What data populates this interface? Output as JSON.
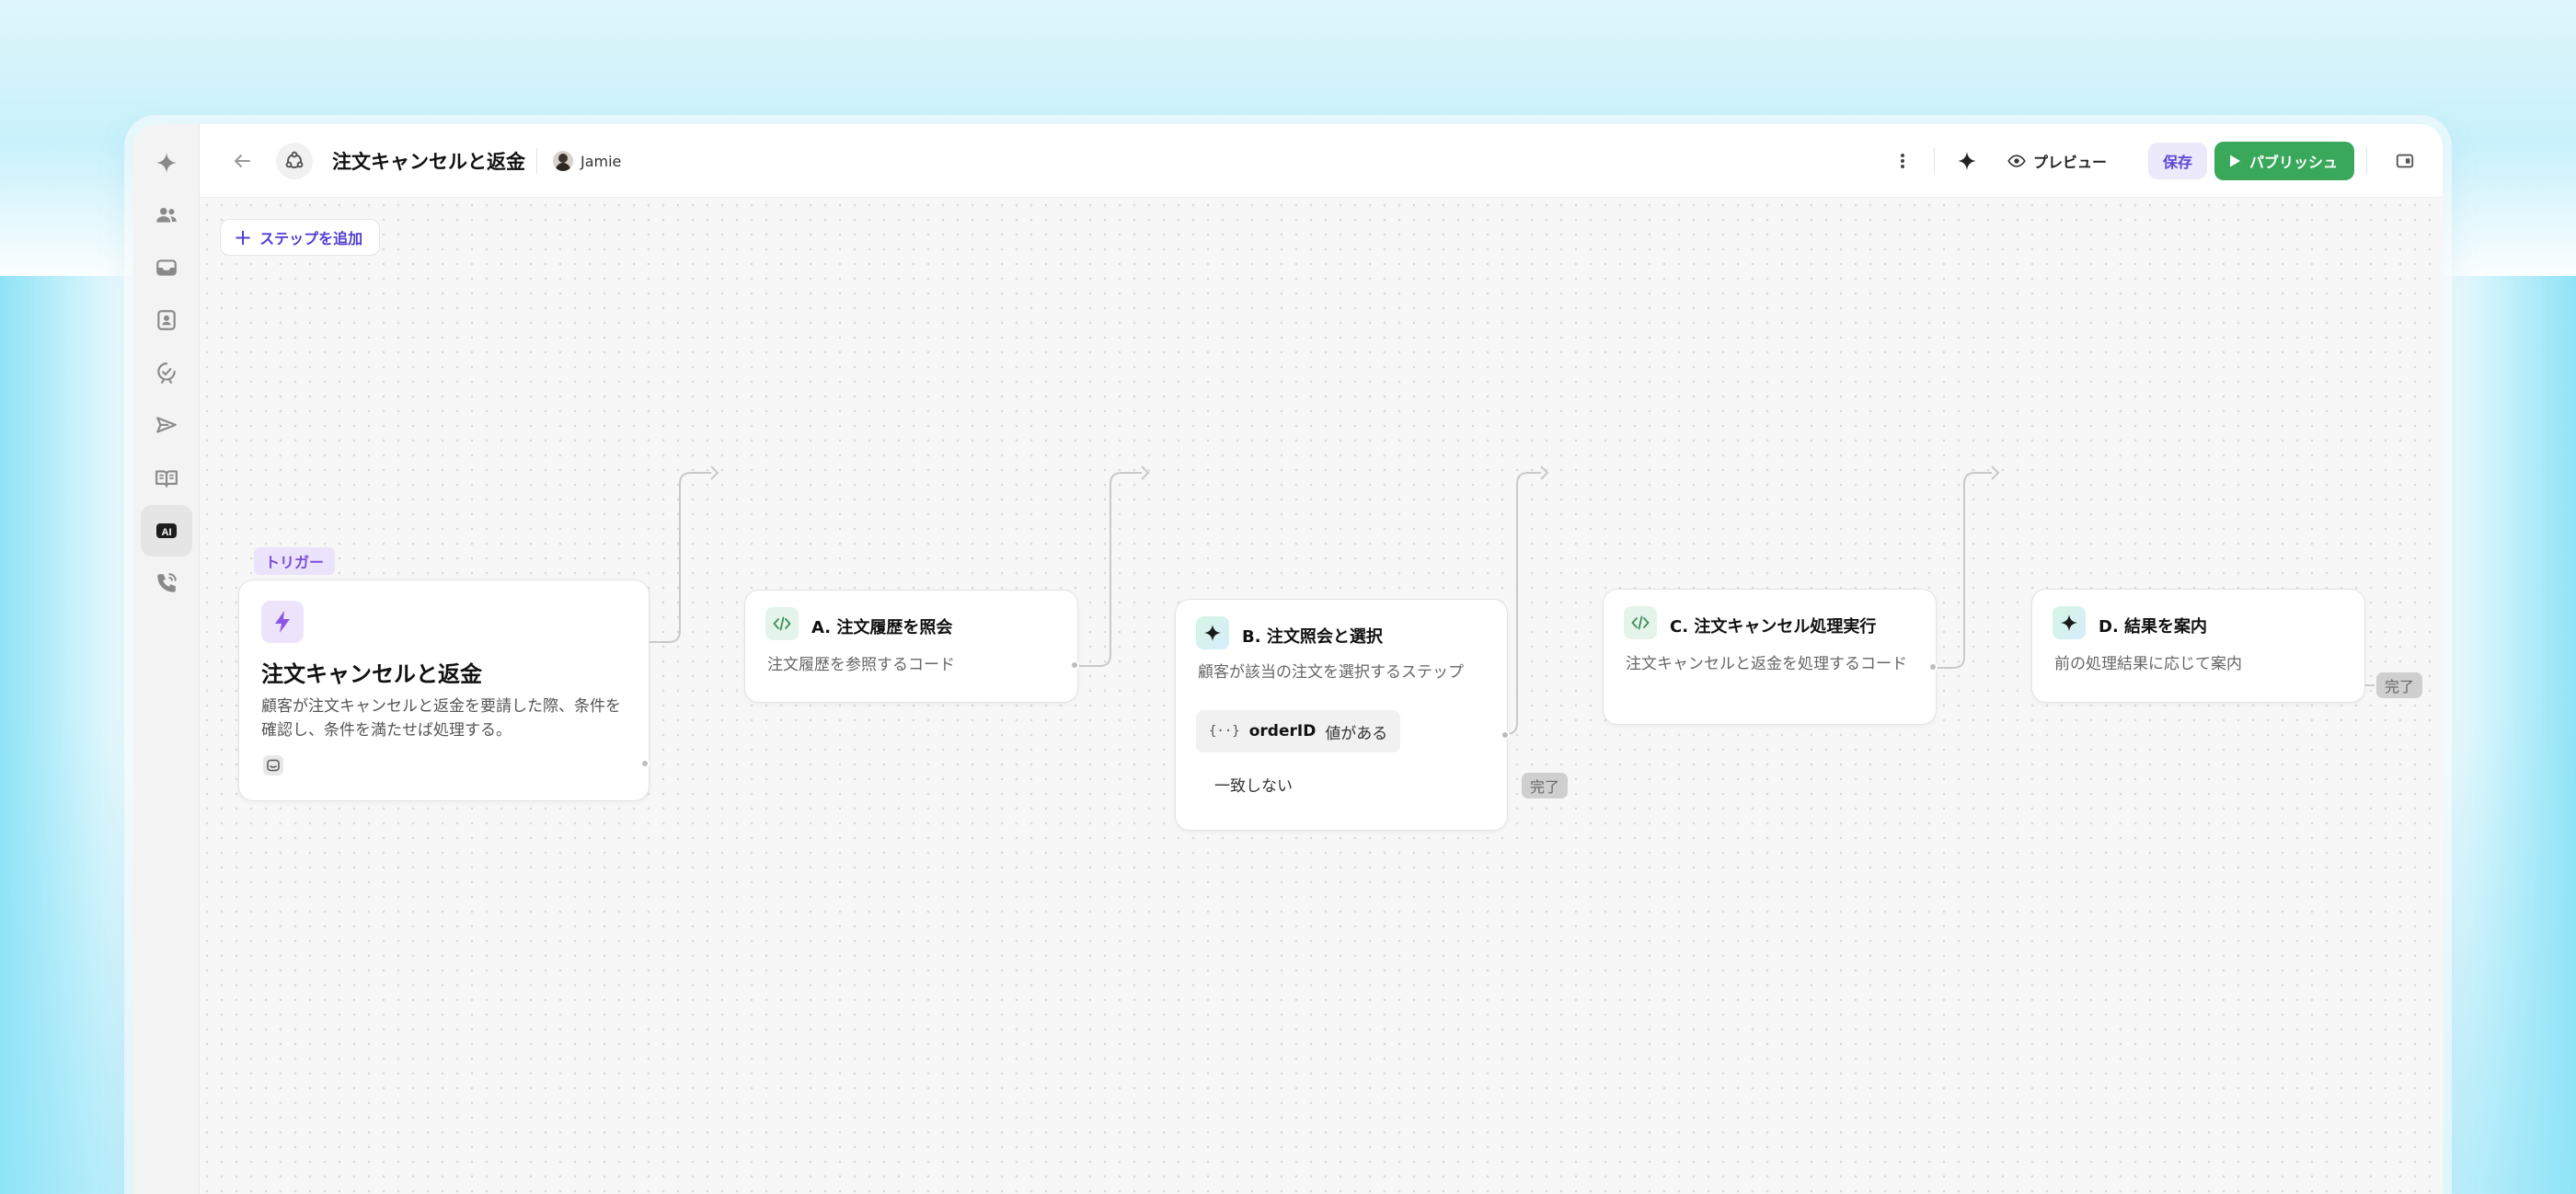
{
  "topbar": {
    "title": "注文キャンセルと返金",
    "owner": "Jamie",
    "preview_label": "プレビュー",
    "save_label": "保存",
    "publish_label": "パブリッシュ"
  },
  "rail": {
    "items": [
      "sparkle",
      "users",
      "inbox",
      "contacts",
      "verified",
      "send",
      "knowledge",
      "ai",
      "phone"
    ],
    "active": "ai",
    "ai_badge": "AI"
  },
  "canvas": {
    "add_step_label": "ステップを追加",
    "trigger": {
      "tag": "トリガー",
      "title": "注文キャンセルと返金",
      "description": "顧客が注文キャンセルと返金を要請した際、条件を確認し、条件を満たせば処理する。"
    },
    "steps": [
      {
        "title": "A. 注文履歴を照会",
        "description": "注文履歴を参照するコード",
        "kind": "code"
      },
      {
        "title": "B. 注文照会と選択",
        "description": "顧客が該当の注文を選択するステップ",
        "kind": "ai",
        "condition": {
          "variable": "orderID",
          "operator": "値がある"
        },
        "fallback": "一致しない",
        "fallback_end": "完了"
      },
      {
        "title": "C. 注文キャンセル処理実行",
        "description": "注文キャンセルと返金を処理するコード",
        "kind": "code"
      },
      {
        "title": "D. 結果を案内",
        "description": "前の処理結果に応じて案内",
        "kind": "ai",
        "end": "完了"
      }
    ]
  },
  "colors": {
    "primary": "#4f3fd1",
    "publish": "#3aa85b",
    "trigger_accent": "#7a4ed8"
  }
}
